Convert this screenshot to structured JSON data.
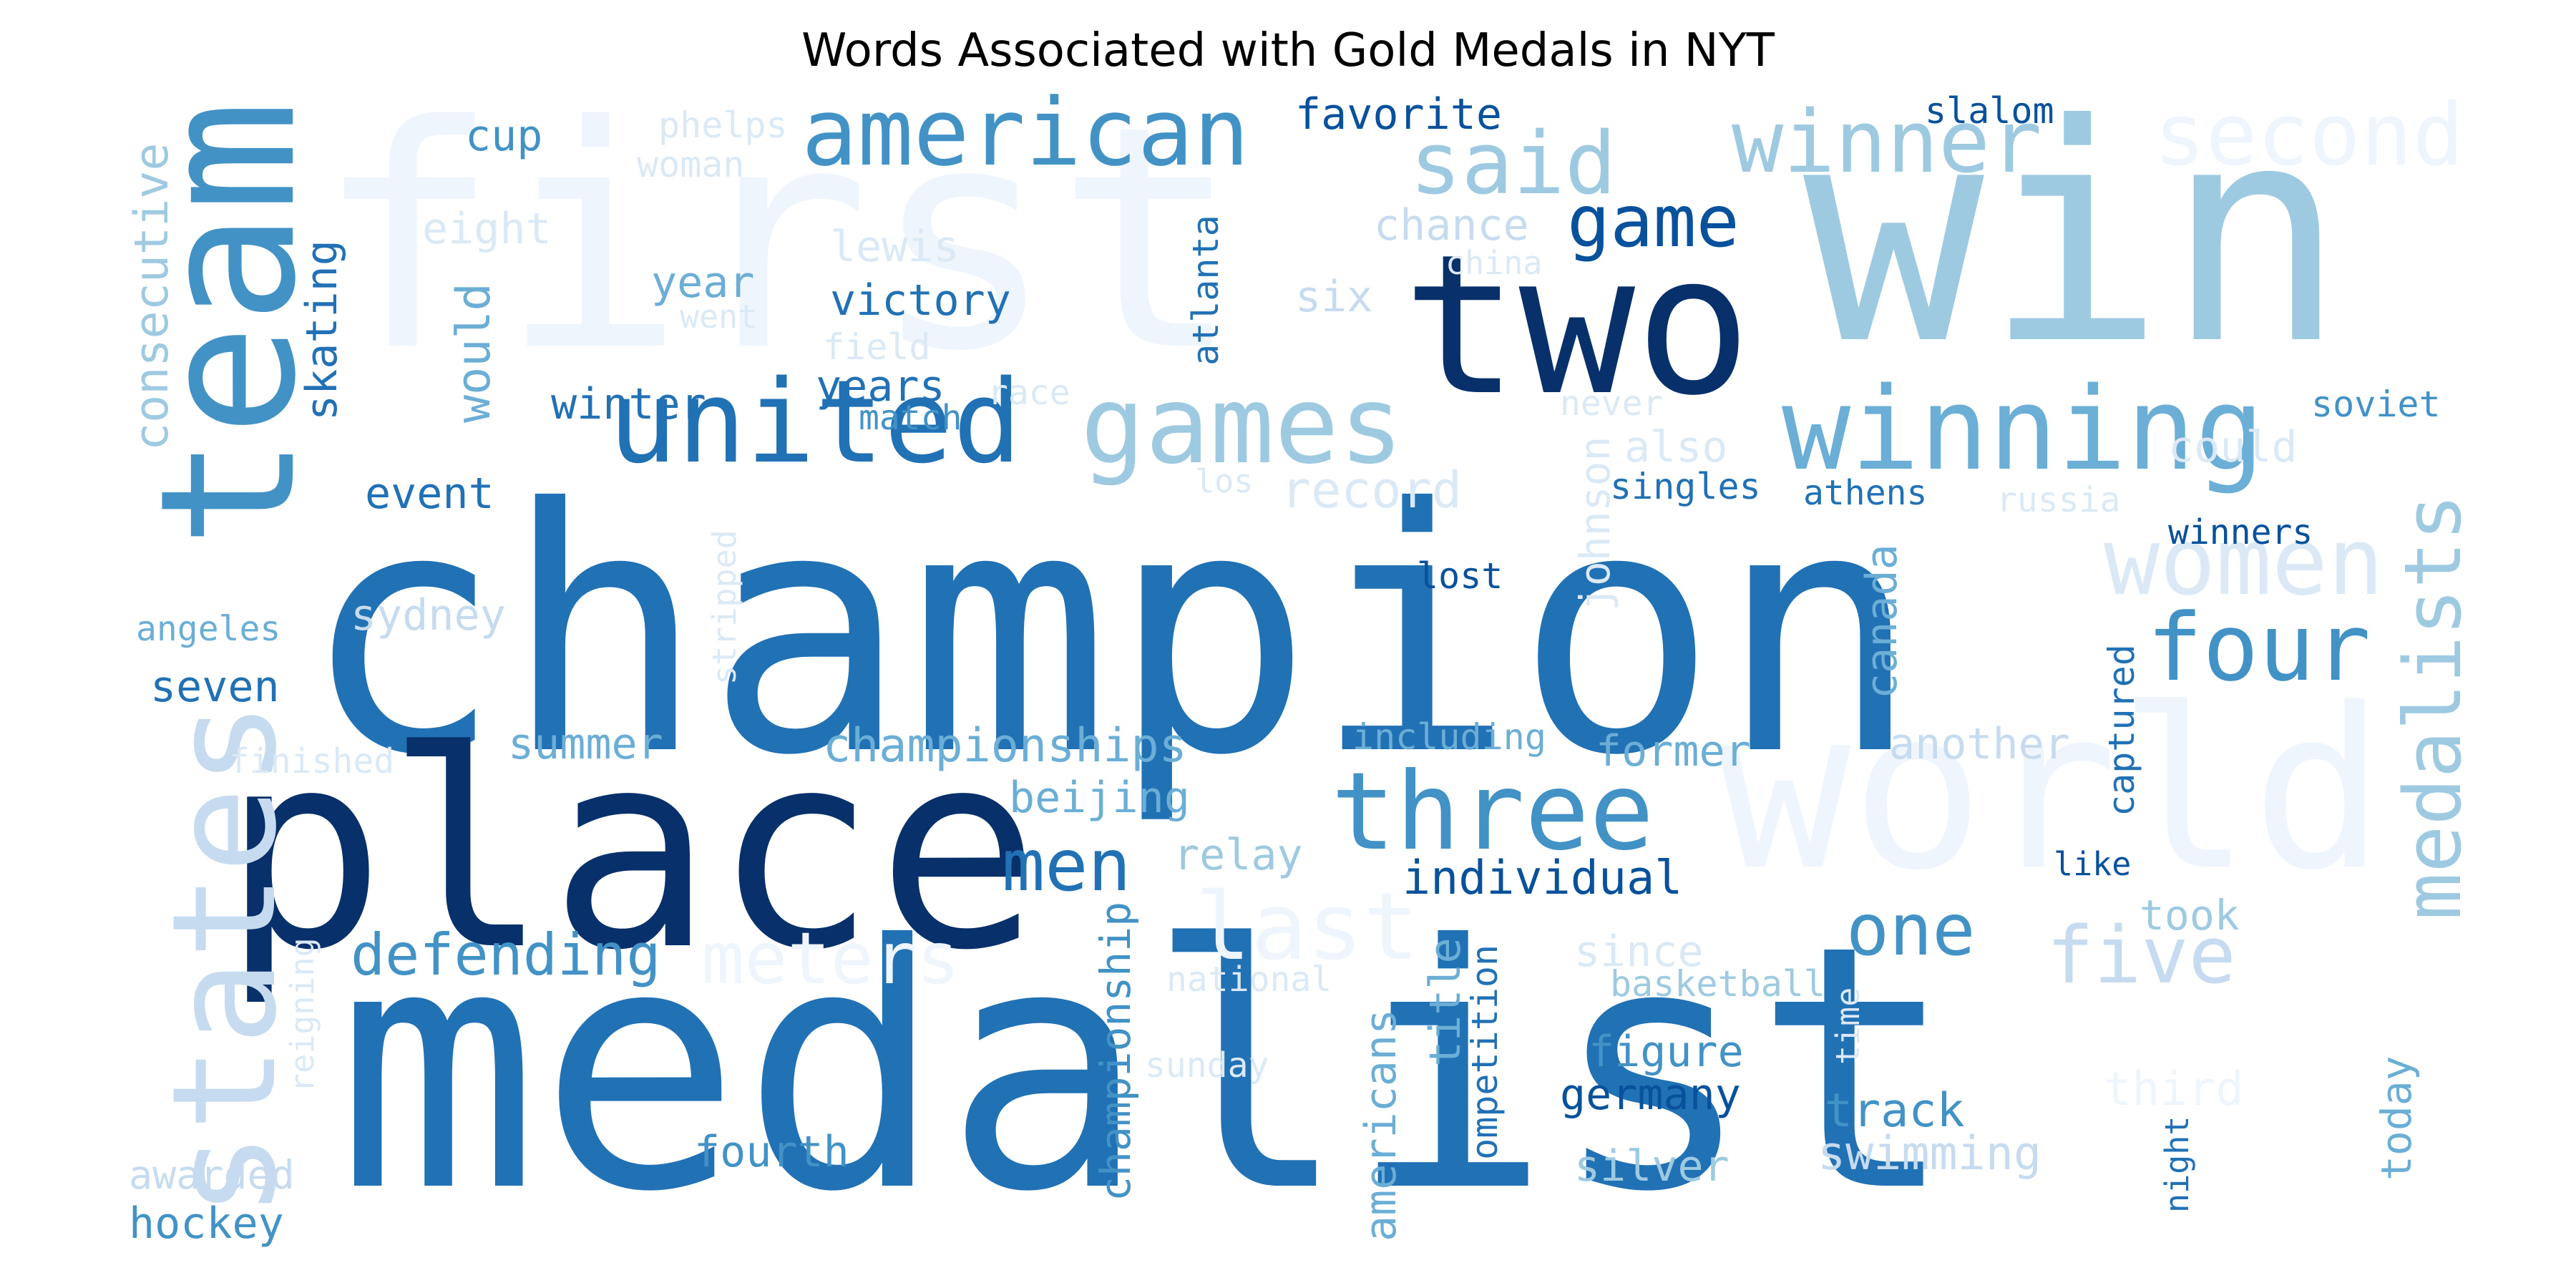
{
  "title": "Words Associated with Gold Medals in NYT",
  "colors": {
    "blue_0": "#eff5fc",
    "blue_1": "#dbe9f6",
    "blue_2": "#c6dbef",
    "blue_3": "#9ecae1",
    "blue_4": "#6baed6",
    "blue_5": "#4292c6",
    "blue_6": "#2171b5",
    "blue_7": "#08519c",
    "blue_8": "#08306b"
  },
  "words": [
    "first",
    "win",
    "champion",
    "medalist",
    "place",
    "two",
    "team",
    "world",
    "states",
    "united",
    "games",
    "winning",
    "three",
    "american",
    "said",
    "winner",
    "second",
    "women",
    "medalists",
    "four",
    "last",
    "meters",
    "five",
    "one",
    "men",
    "game",
    "defending",
    "cup",
    "favorite",
    "slalom",
    "phelps",
    "woman",
    "eight",
    "chance",
    "lewis",
    "china",
    "six",
    "year",
    "went",
    "victory",
    "field",
    "atlanta",
    "consecutive",
    "skating",
    "would",
    "winter",
    "years",
    "race",
    "match",
    "never",
    "soviet",
    "also",
    "could",
    "event",
    "record",
    "los",
    "singles",
    "athens",
    "russia",
    "lost",
    "johnson",
    "winners",
    "angeles",
    "sydney",
    "stripped",
    "canada",
    "seven",
    "captured",
    "finished",
    "summer",
    "championships",
    "including",
    "former",
    "another",
    "beijing",
    "relay",
    "individual",
    "like",
    "took",
    "reigning",
    "national",
    "since",
    "basketball",
    "championship",
    "title",
    "time",
    "third",
    "sunday",
    "figure",
    "germany",
    "competition",
    "americans",
    "track",
    "today",
    "night",
    "awarded",
    "fourth",
    "silver",
    "swimming",
    "hockey"
  ]
}
